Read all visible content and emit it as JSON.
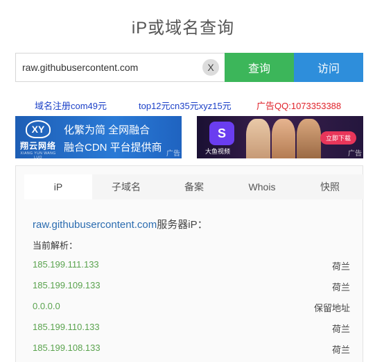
{
  "page": {
    "title": "iP或域名查询"
  },
  "search": {
    "value": "raw.githubusercontent.com",
    "clear_label": "X",
    "query_label": "查询",
    "visit_label": "访问"
  },
  "ad_links": [
    {
      "text": "域名注册com49元",
      "color": "#1a3fc7"
    },
    {
      "text": "top12元cn35元xyz15元",
      "color": "#1a3fc7"
    },
    {
      "text": "广告QQ:1073353388",
      "color": "#e0222a"
    }
  ],
  "banners": {
    "left": {
      "logo_text": "翔云网络",
      "logo_sub": "XIANG YUN WANG LUO",
      "line1": "化繁为简  全网融合",
      "line2": "融合CDN 平台提供商",
      "ad_tag": "广告"
    },
    "right": {
      "app_name": "大鱼视频",
      "download_label": "立即下载",
      "ad_tag": "广告"
    }
  },
  "tabs": [
    {
      "label": "iP",
      "active": true
    },
    {
      "label": "子域名",
      "active": false
    },
    {
      "label": "备案",
      "active": false
    },
    {
      "label": "Whois",
      "active": false
    },
    {
      "label": "快照",
      "active": false
    }
  ],
  "result": {
    "domain": "raw.githubusercontent.com",
    "domain_suffix": "服务器iP：",
    "current_label": "当前解析：",
    "rows": [
      {
        "ip": "185.199.111.133",
        "location": "荷兰"
      },
      {
        "ip": "185.199.109.133",
        "location": "荷兰"
      },
      {
        "ip": "0.0.0.0",
        "location": "保留地址"
      },
      {
        "ip": "185.199.110.133",
        "location": "荷兰"
      },
      {
        "ip": "185.199.108.133",
        "location": "荷兰"
      }
    ]
  },
  "colors": {
    "query_button": "#3cb65a",
    "visit_button": "#2e8edb",
    "ip_text": "#5aa34e",
    "domain_link": "#2b6cb0"
  }
}
